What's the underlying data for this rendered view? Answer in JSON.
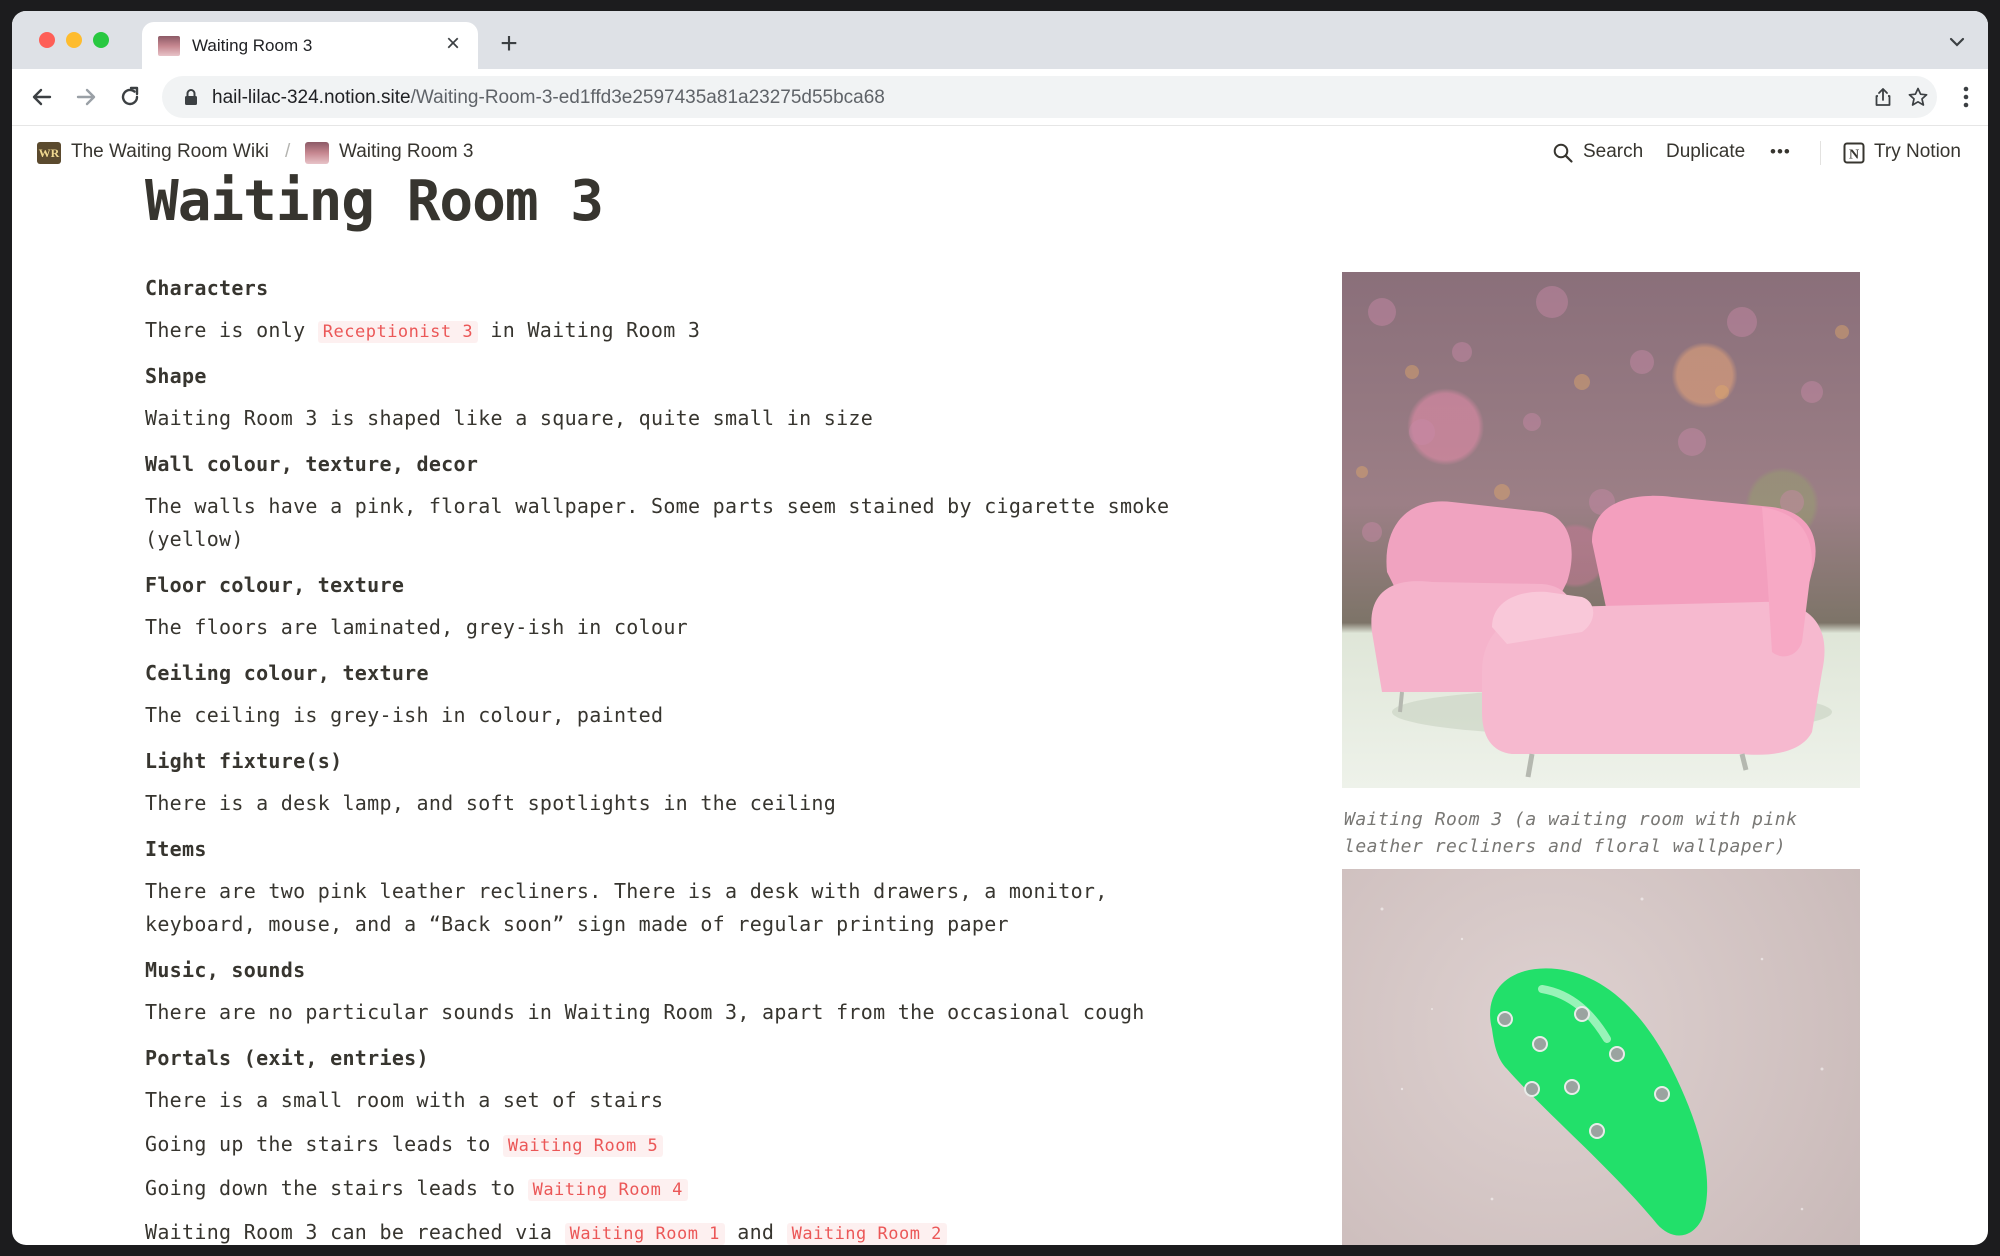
{
  "browser": {
    "tab_title": "Waiting Room 3",
    "url_host": "hail-lilac-324.notion.site",
    "url_path": "/Waiting-Room-3-ed1ffd3e2597435a81a23275d55bca68"
  },
  "breadcrumb": {
    "wiki_icon_text": "WR",
    "wiki_title": "The Waiting Room Wiki",
    "separator": "/",
    "page_title": "Waiting Room 3"
  },
  "topbar": {
    "search_label": "Search",
    "duplicate_label": "Duplicate",
    "more_label": "•••",
    "try_notion_label": "Try Notion"
  },
  "page": {
    "title": "Waiting Room 3",
    "sections": {
      "characters": {
        "heading": "Characters",
        "pre": "There is only ",
        "mention": "Receptionist 3",
        "post": " in Waiting Room 3"
      },
      "shape": {
        "heading": "Shape",
        "text": "Waiting Room 3 is shaped like a square, quite small in size"
      },
      "wall": {
        "heading": "Wall colour, texture, decor",
        "line1": "The walls have a pink, floral wallpaper. Some parts seem stained by cigarette smoke",
        "line2": "(yellow)"
      },
      "floor": {
        "heading": "Floor colour, texture",
        "text": "The floors are laminated, grey-ish in colour"
      },
      "ceiling": {
        "heading": "Ceiling colour, texture",
        "text": "The ceiling is grey-ish in colour, painted"
      },
      "light": {
        "heading": "Light fixture(s)",
        "text": "There is a desk lamp, and soft spotlights in the ceiling"
      },
      "items": {
        "heading": "Items",
        "line1": "There are two pink leather recliners. There is a desk with drawers, a monitor,",
        "line2": "keyboard, mouse, and a “Back soon” sign made of regular printing paper"
      },
      "music": {
        "heading": "Music, sounds",
        "text": "There are no particular sounds in Waiting Room 3, apart from the occasional cough"
      },
      "portals": {
        "heading": "Portals (exit, entries)",
        "line1": "There is a small room with a set of stairs",
        "up_pre": "Going up the stairs leads to ",
        "up_mention": "Waiting Room 5",
        "down_pre": "Going down the stairs leads to ",
        "down_mention": "Waiting Room 4",
        "via_pre": "Waiting Room 3 can be reached via ",
        "via_mention1": "Waiting Room 1",
        "via_and": " and ",
        "via_mention2": "Waiting Room 2"
      }
    },
    "image1_caption": "Waiting Room 3 (a waiting room with pink leather recliners and floral wallpaper)"
  },
  "colors": {
    "mention": "#eb5757",
    "text": "#37352f",
    "caption": "#787774",
    "nail_green": "#22e06a",
    "recliner_pink": "#f3a9c3"
  }
}
